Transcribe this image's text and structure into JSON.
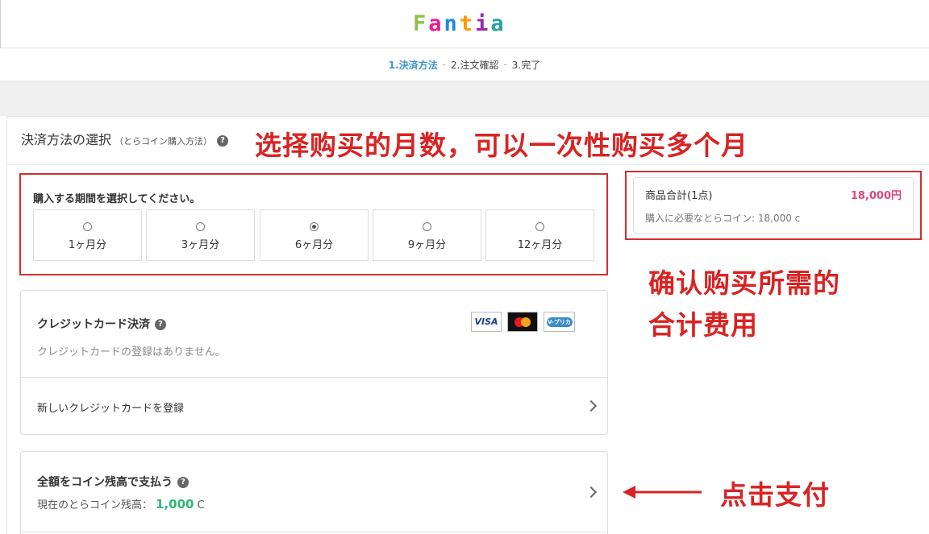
{
  "header": {
    "logo": [
      "F",
      "a",
      "n",
      "t",
      "i",
      "a"
    ],
    "logo_colors": [
      "#8bc34a",
      "#e91e8c",
      "#1e88e5",
      "#ff9800",
      "#9c27b0",
      "#26a69a"
    ]
  },
  "steps": {
    "items": [
      "1.決済方法",
      "2.注文確認",
      "3.完了"
    ],
    "separator": "-",
    "active_index": 0,
    "active_color": "#3a95c9"
  },
  "payment": {
    "title": "決済方法の選択",
    "subtitle": "（とらコイン購入方法）",
    "help_glyph": "?",
    "period_prompt": "購入する期間を選択してください。",
    "periods": [
      {
        "label": "1ヶ月分",
        "selected": false
      },
      {
        "label": "3ヶ月分",
        "selected": false
      },
      {
        "label": "6ヶ月分",
        "selected": true
      },
      {
        "label": "9ヶ月分",
        "selected": false
      },
      {
        "label": "12ヶ月分",
        "selected": false
      }
    ]
  },
  "summary": {
    "label": "商品合計(1点)",
    "price": "18,000円",
    "coins_needed": "購入に必要なとらコイン: 18,000 c",
    "price_color": "#e0467c"
  },
  "credit_card": {
    "title": "クレジットカード決済",
    "help_glyph": "?",
    "none_registered": "クレジットカードの登録はありません。",
    "new_card": "新しいクレジットカードを登録",
    "logos": {
      "visa": "VISA",
      "mastercard_caption": "mastercard",
      "vpreca": "V-プリカ"
    }
  },
  "coin_payment": {
    "title": "全額をコイン残高で支払う",
    "help_glyph": "?",
    "balance_label": "現在のとらコイン残高：",
    "balance_value": "1,000",
    "balance_unit": "C",
    "balance_color": "#2eb873"
  },
  "annotations": {
    "select_months": "选择购买的月数，可以一次性购买多个月",
    "confirm_total_line1": "确认购买所需的",
    "confirm_total_line2": "合计费用",
    "click_pay": "点击支付",
    "color": "#d92323"
  }
}
